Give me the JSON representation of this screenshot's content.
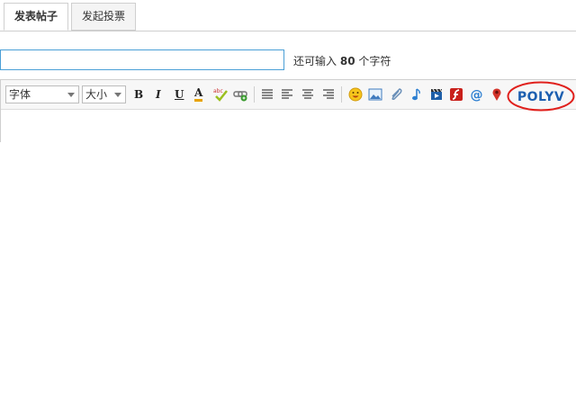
{
  "tabs": [
    {
      "label": "发表帖子",
      "active": true
    },
    {
      "label": "发起投票",
      "active": false
    }
  ],
  "subject": {
    "value": "",
    "counter_prefix": "还可输入",
    "counter_number": "80",
    "counter_suffix": "个字符"
  },
  "toolbar": {
    "font_family": "字体",
    "font_size": "大小",
    "bold": "B",
    "italic": "I",
    "underline": "U",
    "font_color": "A",
    "polyv_label": "POLYV",
    "icons": [
      "bold-icon",
      "italic-icon",
      "underline-icon",
      "font-color-icon",
      "spellcheck-icon",
      "link-icon",
      "align-justify-icon",
      "align-left-icon",
      "align-center-icon",
      "align-right-icon",
      "emoji-icon",
      "image-icon",
      "attachment-icon",
      "music-icon",
      "video-icon",
      "flash-icon",
      "at-mention-icon",
      "map-pin-icon",
      "polyv-icon"
    ]
  },
  "colors": {
    "accent": "#4a9fd6",
    "highlight_circle": "#e0201c",
    "polyv_blue": "#1d5fb0"
  }
}
